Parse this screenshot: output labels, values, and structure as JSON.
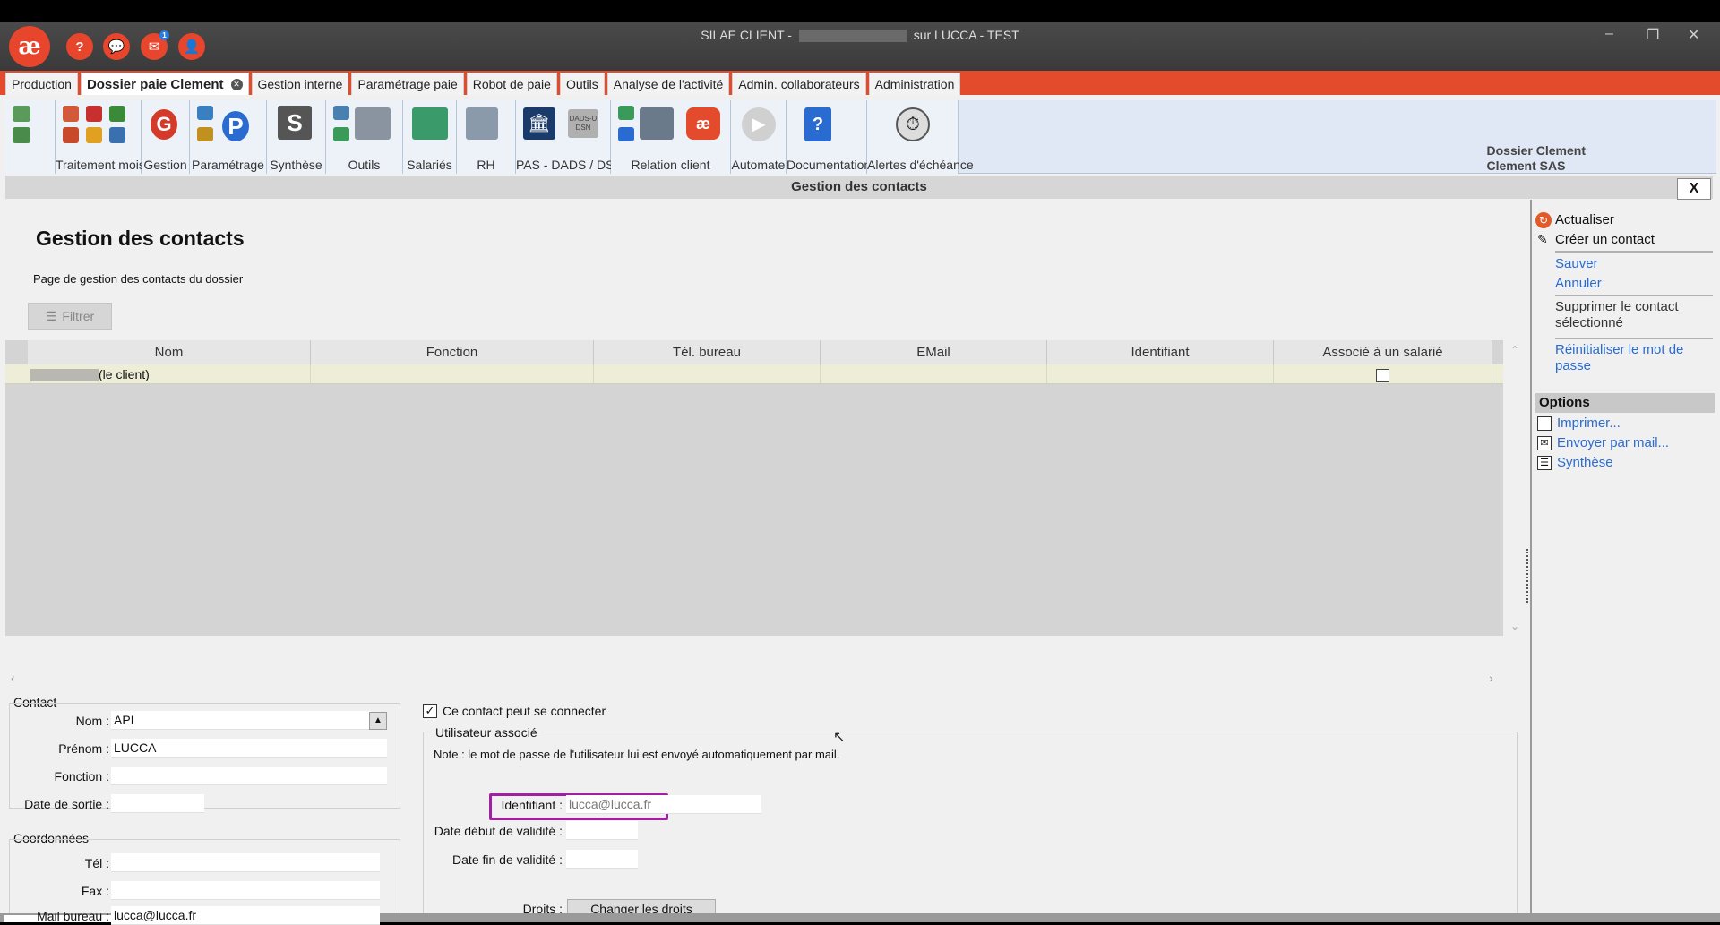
{
  "window": {
    "title_prefix": "SILAE CLIENT -",
    "title_suffix": "sur LUCCA - TEST",
    "min": "–",
    "restore": "❐",
    "close": "✕",
    "notification_count": "1"
  },
  "tabs": [
    {
      "label": "Production"
    },
    {
      "label": "Dossier paie Clement",
      "active": true
    },
    {
      "label": "Gestion interne"
    },
    {
      "label": "Paramétrage paie"
    },
    {
      "label": "Robot de paie"
    },
    {
      "label": "Outils"
    },
    {
      "label": "Analyse de l'activité"
    },
    {
      "label": "Admin. collaborateurs"
    },
    {
      "label": "Administration"
    }
  ],
  "ribbon": {
    "groups": [
      "Traitement mois",
      "Gestion",
      "Paramétrage",
      "Synthèse",
      "Outils",
      "Salariés",
      "RH",
      "PAS - DADS / DSN",
      "Relation client",
      "Automate",
      "Documentation",
      "Alertes d'échéance"
    ],
    "dossier_line1": "Dossier Clement",
    "dossier_line2": "Clement SAS",
    "dads_text": "DADS-U DSN"
  },
  "strip_title": "Gestion des contacts",
  "close_label": "X",
  "page": {
    "heading": "Gestion des contacts",
    "subheading": "Page de gestion des contacts du dossier",
    "filter_label": "Filtrer"
  },
  "grid": {
    "columns": [
      "Nom",
      "Fonction",
      "Tél. bureau",
      "EMail",
      "Identifiant",
      "Associé à un salarié"
    ],
    "rows": [
      {
        "nom": "(le client)",
        "fonction": "",
        "tel": "",
        "email": "",
        "identifiant": "",
        "associe": false
      }
    ]
  },
  "contact": {
    "section": "Contact",
    "nom_label": "Nom :",
    "nom_value": "API",
    "prenom_label": "Prénom :",
    "prenom_value": "LUCCA",
    "fonction_label": "Fonction :",
    "fonction_value": "",
    "sortie_label": "Date de sortie :",
    "sortie_value": ""
  },
  "coords": {
    "section": "Coordonnées",
    "tel_label": "Tél :",
    "tel_value": "",
    "fax_label": "Fax :",
    "fax_value": "",
    "mail_label": "Mail bureau :",
    "mail_value": "lucca@lucca.fr"
  },
  "login": {
    "checkbox_label": "Ce contact peut se connecter",
    "checked": true,
    "group_label": "Utilisateur associé",
    "note": "Note : le mot de passe de l'utilisateur lui est envoyé automatiquement par mail.",
    "identifiant_label": "Identifiant :",
    "identifiant_value": "lucca@lucca.fr",
    "debut_label": "Date début de validité :",
    "fin_label": "Date fin de validité :",
    "droits_label": "Droits :",
    "droits_button": "Changer les droits"
  },
  "actions": {
    "actualiser": "Actualiser",
    "creer": "Créer un contact",
    "sauver": "Sauver",
    "annuler": "Annuler",
    "supprimer": "Supprimer le contact sélectionné",
    "reinit": "Réinitialiser le mot de passe",
    "options": "Options",
    "imprimer": "Imprimer...",
    "envoyer": "Envoyer par mail...",
    "synthese": "Synthèse"
  },
  "colors": {
    "accent": "#e44a2c",
    "link": "#2a6bd1",
    "highlight_box": "#a020a0",
    "row_highlight": "#eeeed8"
  }
}
